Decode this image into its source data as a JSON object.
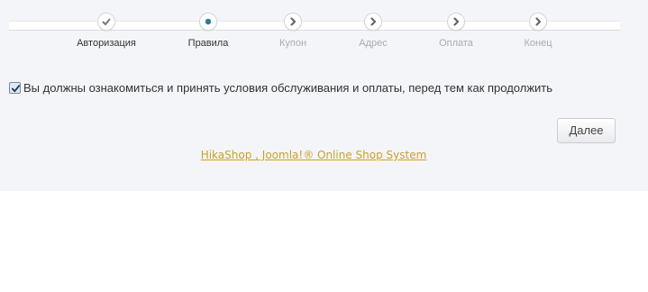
{
  "steps": [
    {
      "label": "Авторизация",
      "state": "done",
      "icon": "check-icon"
    },
    {
      "label": "Правила",
      "state": "active",
      "icon": "current-dot-icon"
    },
    {
      "label": "Купон",
      "state": "todo",
      "icon": "chevron-right-icon"
    },
    {
      "label": "Адрес",
      "state": "todo",
      "icon": "chevron-right-icon"
    },
    {
      "label": "Оплата",
      "state": "todo",
      "icon": "chevron-right-icon"
    },
    {
      "label": "Конец",
      "state": "todo",
      "icon": "chevron-right-icon"
    }
  ],
  "terms": {
    "checked": true,
    "text": "Вы должны ознакомиться и принять условия обслуживания и оплаты, перед тем как продолжить"
  },
  "next_button": {
    "label": "Далее"
  },
  "footer": {
    "link_text": "HikaShop , Joomla!® Online Shop System"
  },
  "colors": {
    "panel_bg": "#f4f5f8",
    "active_dot": "#2a7f96",
    "link": "#c9a128",
    "muted_label": "#a8abb0"
  }
}
